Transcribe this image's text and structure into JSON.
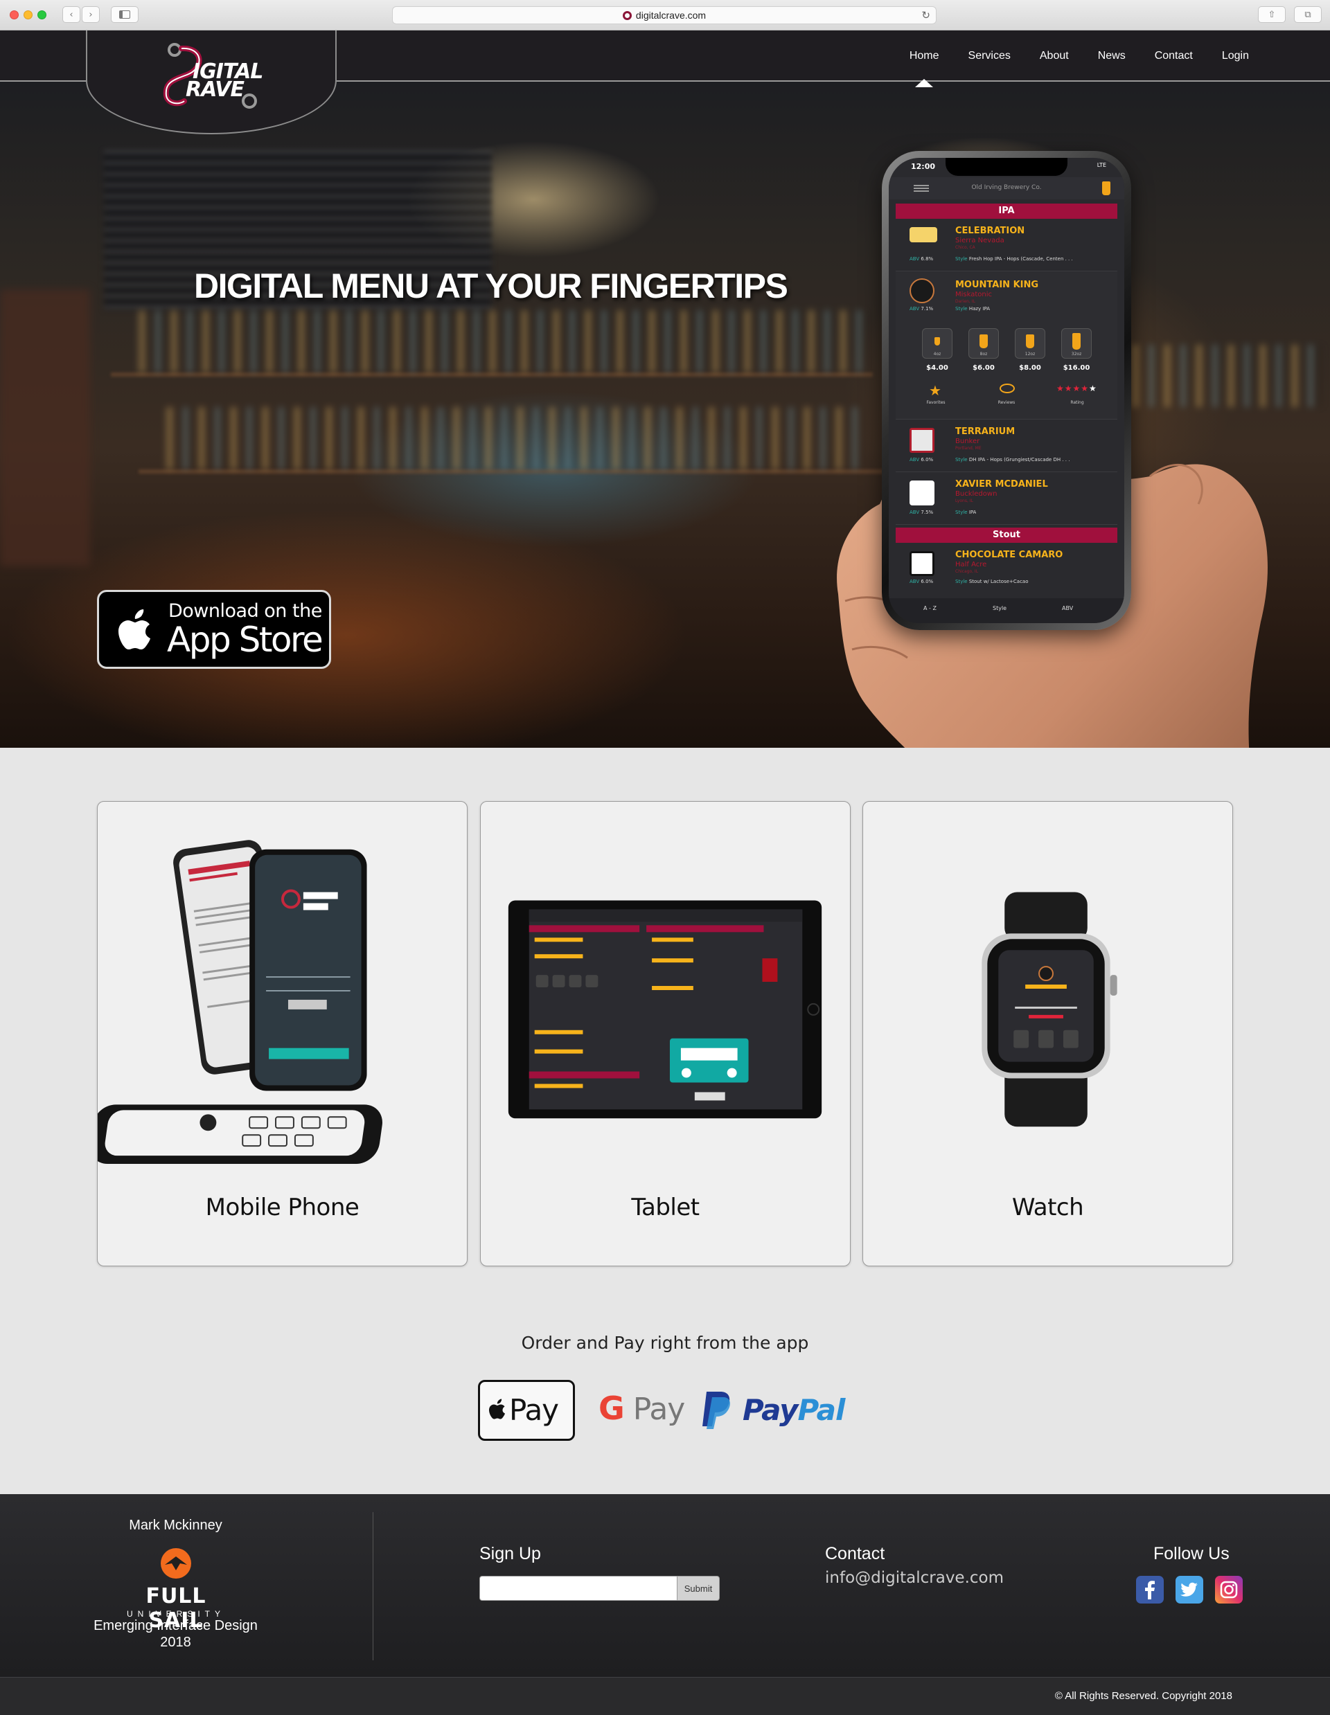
{
  "browser": {
    "url": "digitalcrave.com",
    "back_icon": "chevron-left-icon",
    "forward_icon": "chevron-right-icon",
    "sidebar_icon": "sidebar-icon",
    "reload_icon": "reload-icon",
    "share_icon": "share-icon",
    "tabs_icon": "tabs-icon"
  },
  "header": {
    "logo_text_top": "IGITAL",
    "logo_text_bottom": "RAVE",
    "nav": [
      {
        "label": "Home",
        "active": true
      },
      {
        "label": "Services"
      },
      {
        "label": "About"
      },
      {
        "label": "News"
      },
      {
        "label": "Contact"
      },
      {
        "label": "Login"
      }
    ]
  },
  "hero": {
    "title": "DIGITAL MENU AT YOUR FINGERTIPS",
    "appstore_line1": "Download on the",
    "appstore_line2": "App Store"
  },
  "phone_app": {
    "time": "12:00",
    "signal": "LTE",
    "brewery": "Old Irving Brewery Co.",
    "sections": [
      "IPA",
      "Stout"
    ],
    "beers": [
      {
        "name": "CELEBRATION",
        "brewery": "Sierra Nevada",
        "location": "Chico, CA",
        "abv": "6.8%",
        "style": "Fresh Hop IPA - Hops (Cascade, Centen . . ."
      },
      {
        "name": "MOUNTAIN KING",
        "brewery": "Miskatonic",
        "location": "Darien, IL",
        "abv": "7.1%",
        "style": "Hazy IPA"
      },
      {
        "name": "TERRARIUM",
        "brewery": "Bunker",
        "location": "Portland, ME",
        "abv": "6.0%",
        "style": "DH IPA - Hops (Grungiest/Cascade DH . . ."
      },
      {
        "name": "XAVIER MCDANIEL",
        "brewery": "Buckledown",
        "location": "Lyons, IL",
        "abv": "7.5%",
        "style": "IPA"
      },
      {
        "name": "CHOCOLATE CAMARO",
        "brewery": "Half Acre",
        "location": "Chicago, IL",
        "abv": "6.0%",
        "style": "Stout w/ Lactose+Cacao"
      }
    ],
    "sizes": [
      {
        "oz": "4oz",
        "price": "$4.00"
      },
      {
        "oz": "8oz",
        "price": "$6.00"
      },
      {
        "oz": "12oz",
        "price": "$8.00"
      },
      {
        "oz": "32oz",
        "price": "$16.00"
      }
    ],
    "actions": [
      "Favorites",
      "Reviews",
      "Rating"
    ],
    "rating": 4,
    "abv_label": "ABV",
    "style_label": "Style",
    "tabs": [
      "A - Z",
      "Style",
      "ABV"
    ]
  },
  "devices": [
    {
      "label": "Mobile Phone"
    },
    {
      "label": "Tablet"
    },
    {
      "label": "Watch"
    }
  ],
  "payment": {
    "heading": "Order and Pay right from the app",
    "apple_pay": "Pay",
    "google_pay_g": "G",
    "google_pay": "Pay",
    "paypal_pay": "Pay",
    "paypal_pal": "Pal"
  },
  "footer": {
    "author": "Mark Mckinney",
    "school_name": "FULL SAIL",
    "school_sub": "UNIVERSITY",
    "course": "Emerging Interface Design",
    "year": "2018",
    "signup_label": "Sign Up",
    "signup_value": "",
    "submit_label": "Submit",
    "contact_label": "Contact",
    "contact_email": "info@digitalcrave.com",
    "follow_label": "Follow Us",
    "social": [
      "facebook-icon",
      "twitter-icon",
      "instagram-icon"
    ],
    "copyright": "© All Rights Reserved. Copyright 2018"
  },
  "colors": {
    "brand": "#a0103d",
    "beer_name": "#f7b31b",
    "accent_teal": "#2fb3a6",
    "header_bg": "#1f1d21",
    "footer_bg": "#2c2c2f"
  }
}
